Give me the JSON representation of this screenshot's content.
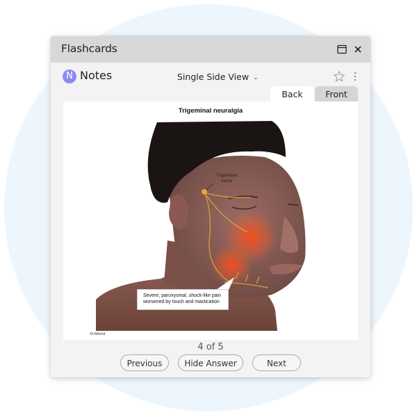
{
  "window": {
    "title": "Flashcards",
    "restore_icon": "window-restore-icon",
    "close_icon": "close-icon"
  },
  "toolbar": {
    "notes_badge": "N",
    "notes_label": "Notes",
    "view_mode": "Single Side View",
    "view_mode_chevron": "⌄",
    "star_icon": "star-outline-icon",
    "more_icon": "more-vertical-icon"
  },
  "tabs": [
    {
      "label": "Back",
      "active": true
    },
    {
      "label": "Front",
      "active": false
    }
  ],
  "card": {
    "title": "Trigeminal neuralgia",
    "nerve_label_line1": "Trigeminal",
    "nerve_label_line2": "nerve",
    "callout_line1": "Severe, paroxysmal, shock-like pain",
    "callout_line2": "worsened by touch and mastication",
    "copyright": "©UWorld"
  },
  "pagination": {
    "counter": "4 of 5",
    "current": 4,
    "total": 5
  },
  "buttons": {
    "previous": "Previous",
    "hide_answer": "Hide Answer",
    "next": "Next"
  },
  "colors": {
    "background_circle": "#eef6fd",
    "titlebar": "#d8d8d8",
    "notes_badge": "#8c8cf0",
    "tab_active": "#ffffff",
    "tab_inactive": "#d5d5d5"
  }
}
